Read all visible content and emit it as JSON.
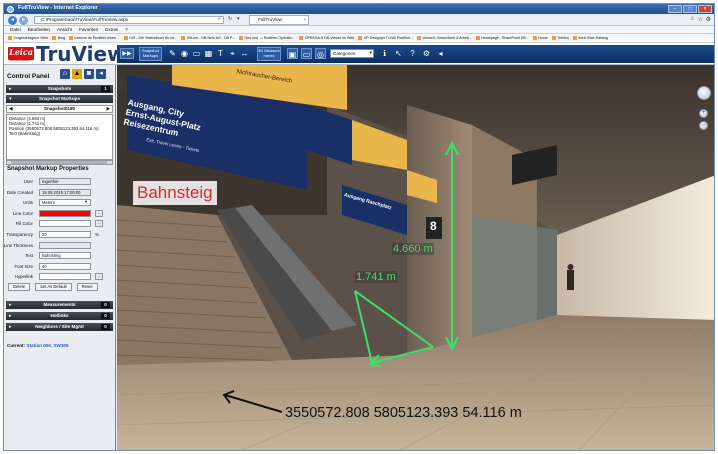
{
  "browser": {
    "title": "FullTruView - Internet Explorer",
    "address": "C:\\ProgramData\\TruView\\FullTruView.aspx",
    "tab_label": "FullTruView",
    "menu": [
      "Datei",
      "Bearbeiten",
      "Ansicht",
      "Favoriten",
      "Extras",
      "?"
    ],
    "favorites": [
      "Vorgeschlagene Sites",
      "Bing",
      "Lexicon de Ermittler eines ...",
      "DIS - Die Telefonbuch für de...",
      "DB-net - DB-Netz AG - DB P...",
      "Geo und — Rodthen Operatio...",
      "OPREDA & DB-Viewer im Web",
      "HP Designjet T1200 PostScri...",
      "Umwelt, Gesundheit & Arbeit...",
      "Homepage - SharePoint DB...",
      "Home",
      "Telefon",
      "Web Slice-Katalog"
    ]
  },
  "app": {
    "logo": "Leica",
    "logo_sub": "Geosystems",
    "product": "TruView",
    "toolbar": {
      "snapshot_label": "Snapshot Markups",
      "measurement_label": "3D Measure ments",
      "layer_select": "Categories"
    }
  },
  "control_panel": {
    "title": "Control Panel",
    "sections": {
      "snapshots": {
        "label": "Snapshots",
        "count": "1"
      },
      "snapshot_markups": {
        "label": "Snapshot Markups"
      }
    },
    "snapshot_nav": "Snapshot0180",
    "info_lines": [
      "Distance (4.660 m)",
      "Distance (1.741 m)",
      "Position (3550572.808 5805123.393 54.116 m)",
      "Text (Bahnsteig)"
    ],
    "properties": {
      "title": "Snapshot Markup Properties",
      "fields": [
        {
          "label": "User",
          "value": "mgerther"
        },
        {
          "label": "Date Created",
          "value": "18.05.2015 17:00:00"
        },
        {
          "label": "Units",
          "value": "Meters"
        },
        {
          "label": "Line Color",
          "value": ""
        },
        {
          "label": "Fill Color",
          "value": ""
        },
        {
          "label": "Transparency",
          "value": "20",
          "unit": "%"
        },
        {
          "label": "Line Thickness",
          "value": ""
        },
        {
          "label": "Text",
          "value": "Bahnsteig"
        },
        {
          "label": "Font Size",
          "value": "40"
        },
        {
          "label": "Hyperlink",
          "value": ""
        }
      ],
      "buttons": [
        "Delete",
        "Set As Default",
        "Reset"
      ]
    },
    "lower_sections": [
      {
        "label": "Measurements",
        "count": "0"
      },
      {
        "label": "Hotlinks",
        "count": "0"
      },
      {
        "label": "Neighbors / Site Mgmt",
        "count": "0"
      }
    ],
    "current_label": "Current:",
    "current_station": "Station 006_SW306"
  },
  "viewer": {
    "text_markup": "Bahnsteig",
    "vertical_distance": "4.660 m",
    "horizontal_distance": "1.741 m",
    "position": "3550572.808 5805123.393 54.116 m",
    "signs": {
      "sign1_lines": [
        "Ausgang, City",
        "Ernst-August-Platz",
        "Reisezentrum"
      ],
      "sign1_sub": "Exit, Travel centre - Tickets",
      "sign2": "Ausgang Raschplatz",
      "overhead_top": "Nichtraucher-Bereich",
      "platform_no": "8"
    },
    "accent": "#39e06a",
    "markup_color": "#d12b2b"
  }
}
